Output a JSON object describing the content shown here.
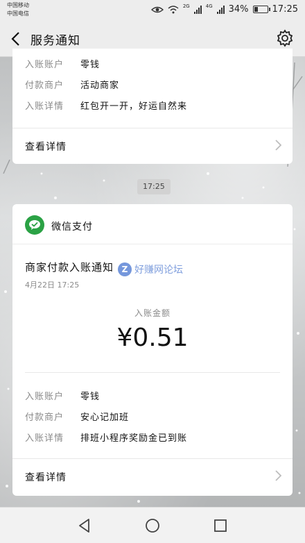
{
  "status_bar": {
    "carrier1": "中国移动",
    "carrier2": "中国电信",
    "net1": "2G",
    "net2": "4G",
    "battery": "34%",
    "battery_level": 0.34,
    "time": "17:25"
  },
  "navbar": {
    "title": "服务通知"
  },
  "card1": {
    "rows": [
      {
        "key": "入账账户",
        "value": "零钱"
      },
      {
        "key": "付款商户",
        "value": "活动商家"
      },
      {
        "key": "入账详情",
        "value": "红包开一开，好运自然来"
      }
    ],
    "link": "查看详情"
  },
  "timestamp": "17:25",
  "card2": {
    "brand": "微信支付",
    "title": "商家付款入账通知",
    "time": "4月22日 17:25",
    "amount_label": "入账金额",
    "amount": "¥0.51",
    "rows": [
      {
        "key": "入账账户",
        "value": "零钱"
      },
      {
        "key": "付款商户",
        "value": "安心记加班"
      },
      {
        "key": "入账详情",
        "value": "排班小程序奖励金已到账"
      }
    ],
    "link": "查看详情"
  },
  "watermark": {
    "logo": "Z",
    "text": "好赚网论坛"
  },
  "icons": {
    "back": "back-arrow-icon",
    "settings": "gear-icon",
    "brand": "wechat-pay-icon",
    "chevron": "chevron-right-icon"
  },
  "colors": {
    "brand_green": "#2ba245",
    "bar_bg": "#ededed"
  }
}
